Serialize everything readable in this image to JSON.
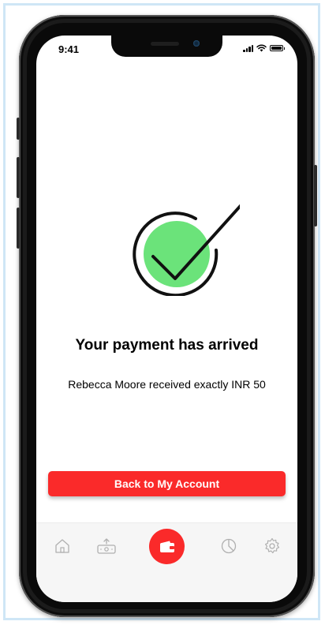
{
  "status_bar": {
    "time": "9:41"
  },
  "success": {
    "icon": "checkmark-circle-icon",
    "title": "Your payment has arrived",
    "message": "Rebecca Moore received exactly INR 50"
  },
  "cta": {
    "label": "Back to My Account"
  },
  "tab_bar": {
    "items": [
      {
        "icon": "home-icon",
        "active": false
      },
      {
        "icon": "transfer-icon",
        "active": false
      },
      {
        "icon": "wallet-icon",
        "active": true
      },
      {
        "icon": "pie-chart-icon",
        "active": false
      },
      {
        "icon": "gear-icon",
        "active": false
      }
    ]
  },
  "colors": {
    "accent": "#fa2a2a",
    "success_green": "#6be37a",
    "tab_icon": "#b0b0b0",
    "frame_border": "#cfe6f6"
  }
}
